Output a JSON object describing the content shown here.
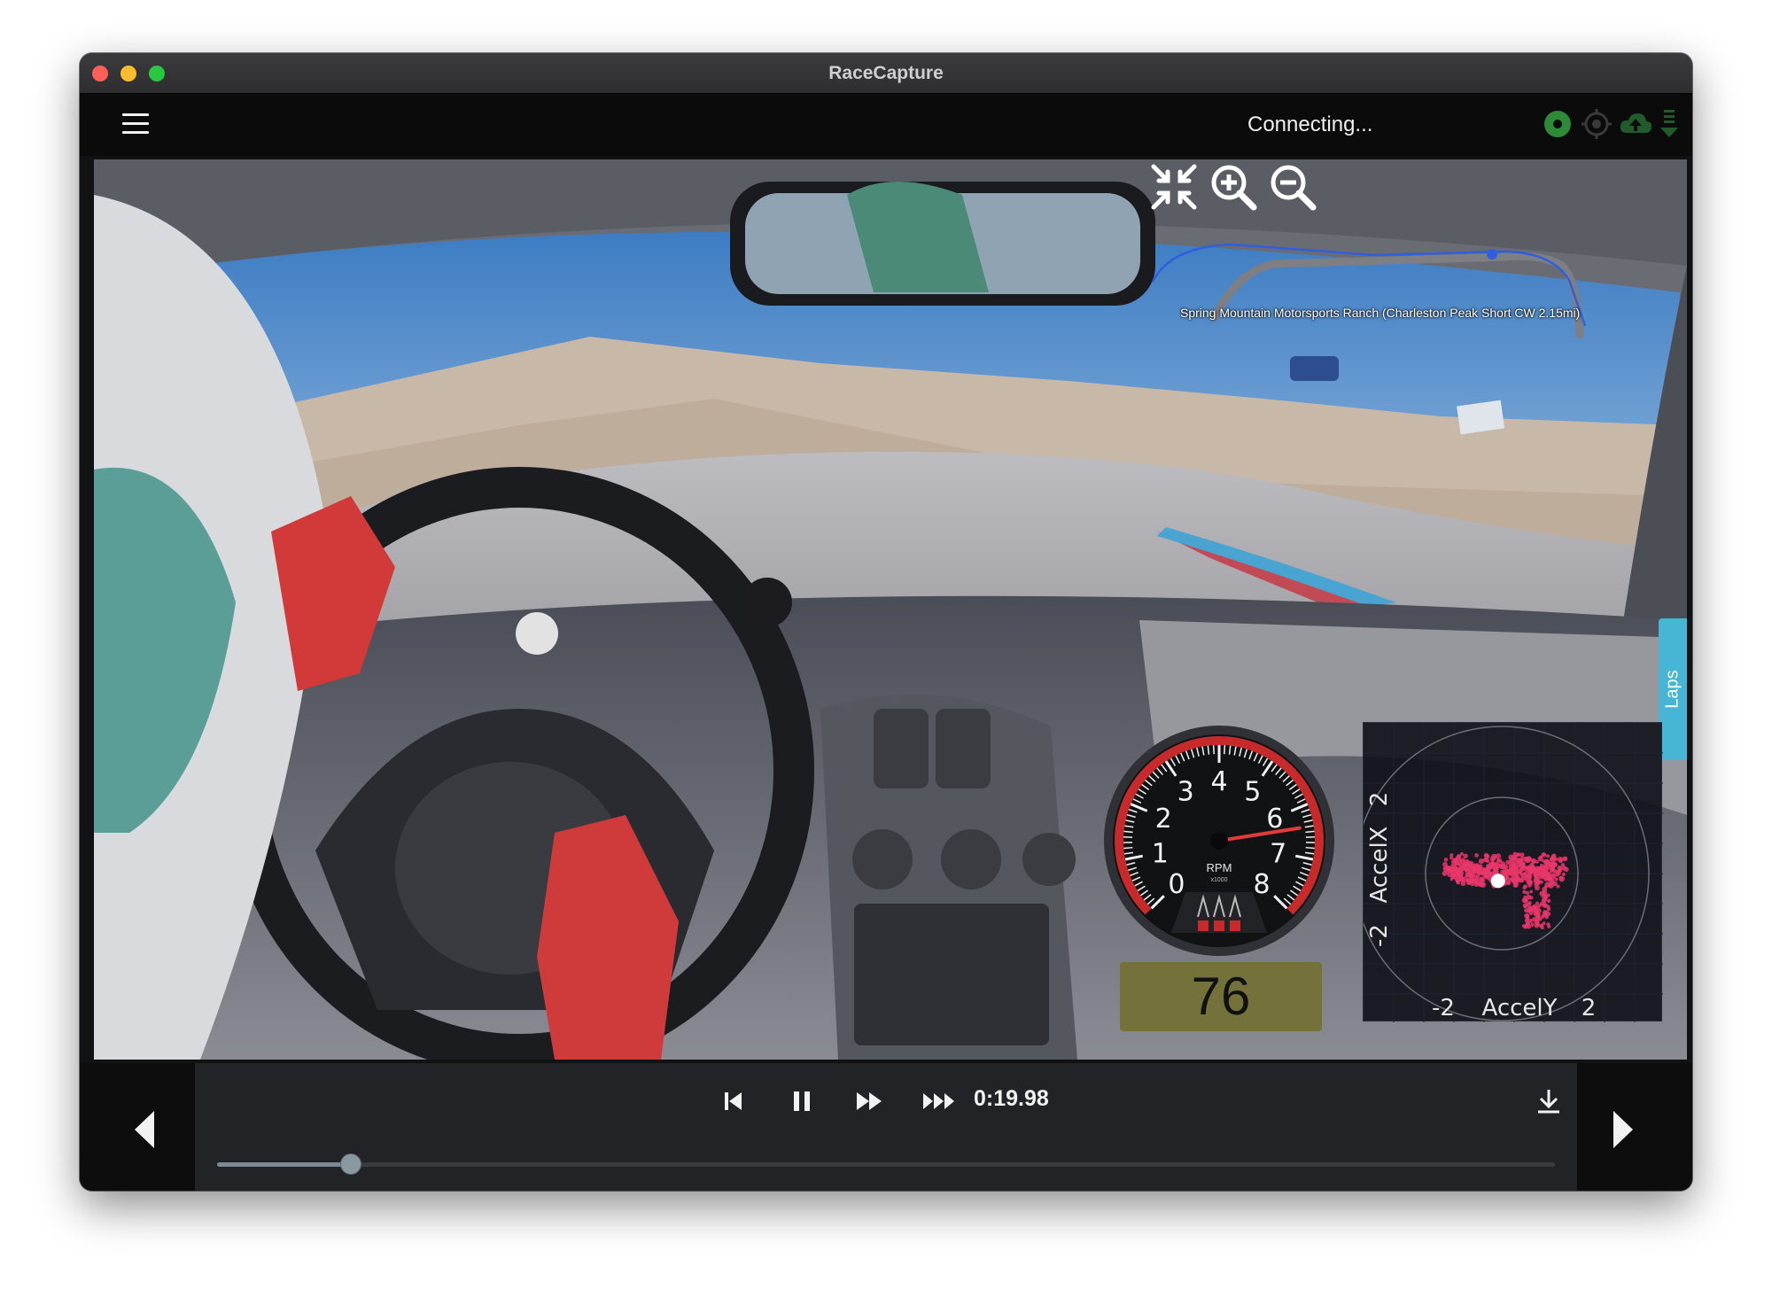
{
  "window": {
    "title": "RaceCapture"
  },
  "appbar": {
    "menu_icon": "hamburger-menu-icon",
    "status": "Connecting...",
    "icons": [
      "gps-status-icon",
      "target-status-icon",
      "cloud-upload-icon",
      "telemetry-stream-icon"
    ],
    "colors": {
      "gps": "#2d8a37",
      "inactive": "#3a3a3a"
    }
  },
  "video": {
    "overlay_icons": [
      "collapse-arrows-icon",
      "zoom-in-icon",
      "zoom-out-icon"
    ],
    "track_name": "Spring Mountain Motorsports Ranch (Charleston Peak Short CW 2.15mi)",
    "laps_tab": "Laps"
  },
  "tachometer": {
    "label": "RPM",
    "sublabel": "x1000",
    "scale": [
      "0",
      "1",
      "2",
      "3",
      "4",
      "5",
      "6",
      "7",
      "8"
    ],
    "value_rpm": 6400,
    "max_rpm": 8000
  },
  "speed": {
    "value": "76"
  },
  "gg_diagram": {
    "x_label": "AccelY",
    "y_label": "AccelX",
    "x_min": "-2",
    "x_max": "2",
    "y_min": "-2",
    "y_max": "2",
    "dot_color": "#e8366a",
    "current_point": {
      "x": -0.05,
      "y": -0.1
    }
  },
  "playback": {
    "time": "0:19.98",
    "progress": 0.1,
    "icons": [
      "skip-to-start-icon",
      "pause-icon",
      "fast-forward-icon",
      "faster-forward-icon",
      "download-icon"
    ],
    "nav_icons": [
      "previous-arrow-icon",
      "next-arrow-icon"
    ]
  }
}
